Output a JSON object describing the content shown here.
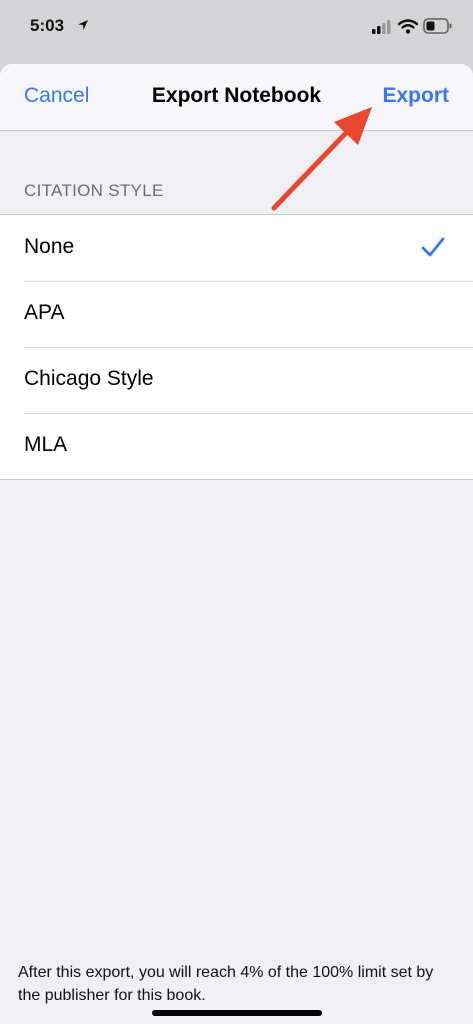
{
  "status_bar": {
    "time": "5:03"
  },
  "nav": {
    "cancel_label": "Cancel",
    "title": "Export Notebook",
    "export_label": "Export"
  },
  "section": {
    "header": "CITATION STYLE",
    "options": [
      {
        "label": "None",
        "selected": true
      },
      {
        "label": "APA",
        "selected": false
      },
      {
        "label": "Chicago Style",
        "selected": false
      },
      {
        "label": "MLA",
        "selected": false
      }
    ]
  },
  "footer": {
    "note": "After this export, you will reach 4% of the 100% limit set by the publisher for this book."
  },
  "colors": {
    "accent": "#3478f6",
    "annotation_arrow": "#e8462e"
  }
}
